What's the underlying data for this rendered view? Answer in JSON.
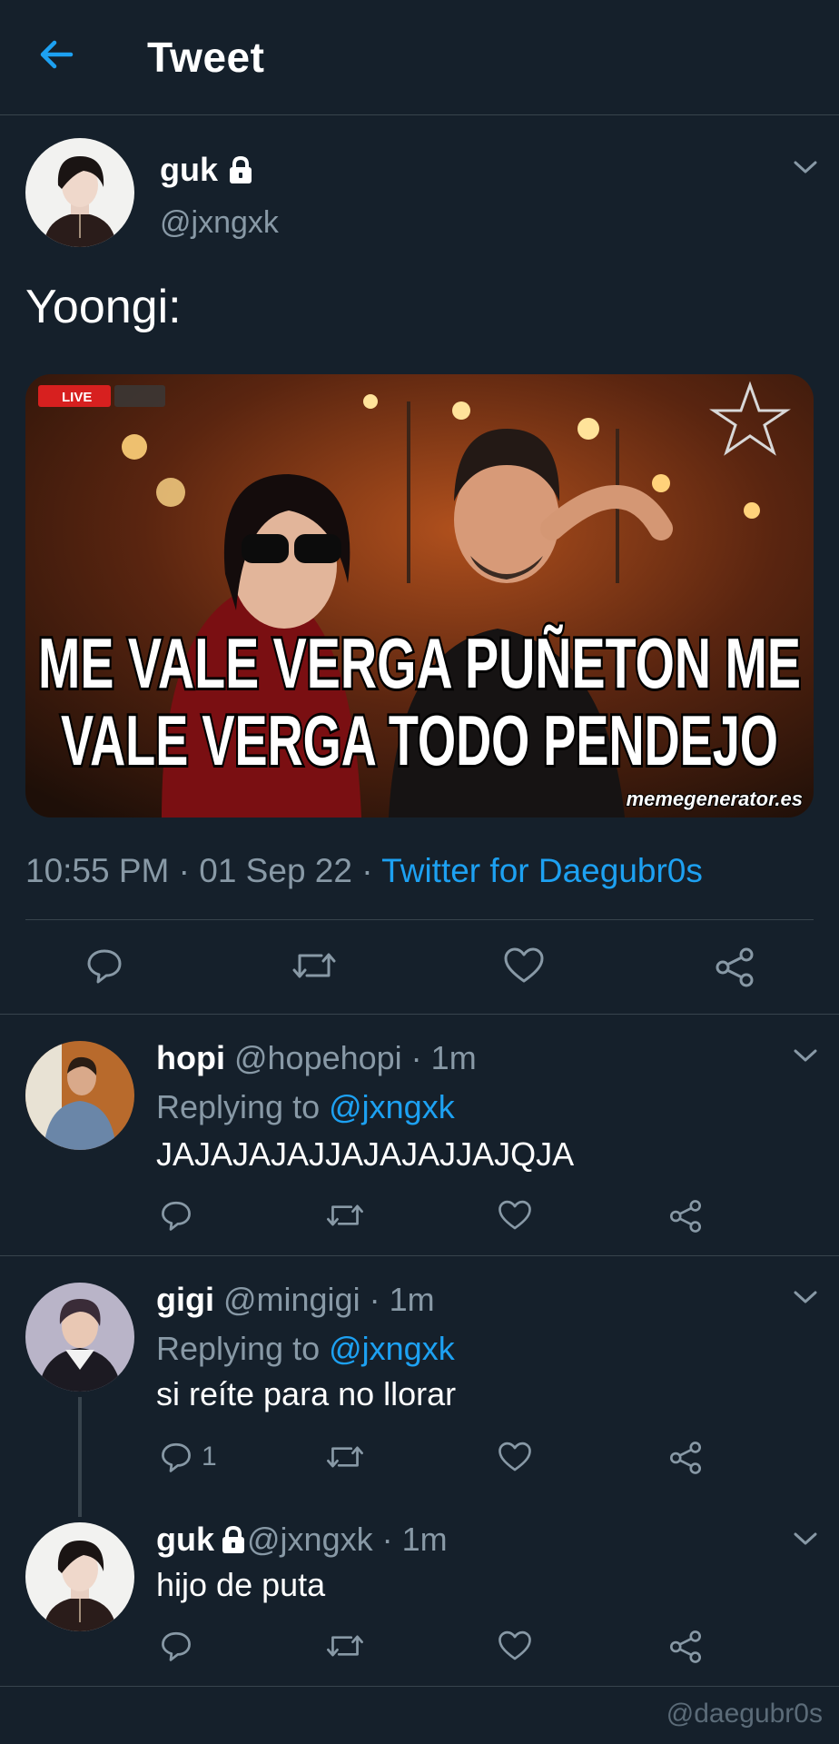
{
  "header": {
    "title": "Tweet",
    "back_icon": "arrow-left-icon"
  },
  "colors": {
    "background": "#15202b",
    "accent": "#1da1f2",
    "muted": "#8899a6",
    "divider": "#38444d"
  },
  "main_tweet": {
    "name": "guk",
    "handle": "@jxngxk",
    "text": "Yoongi:",
    "media": {
      "badge_live": "LIVE",
      "caption_line1": "ME VALE VERGA PUÑETON ME",
      "caption_line2": "VALE VERGA TODO PENDEJO",
      "source": "memegenerator.es"
    },
    "time": "10:55 PM · 01 Sep 22 · ",
    "client": "Twitter for Daegubr0s"
  },
  "replies": [
    {
      "name": "hopi",
      "handle": " @hopehopi · 1m",
      "replying_prefix": "Replying to ",
      "replying_to": "@jxngxk",
      "text": "JAJAJAJAJJAJAJAJJAJQJA",
      "reply_count": ""
    },
    {
      "name": "gigi",
      "handle": " @mingigi · 1m",
      "replying_prefix": "Replying to ",
      "replying_to": "@jxngxk",
      "text": "si reíte para no llorar",
      "reply_count": "1"
    },
    {
      "name": "guk",
      "handle": " @jxngxk · 1m",
      "text": "hijo de puta",
      "reply_count": ""
    }
  ],
  "watermark": "@daegubr0s"
}
